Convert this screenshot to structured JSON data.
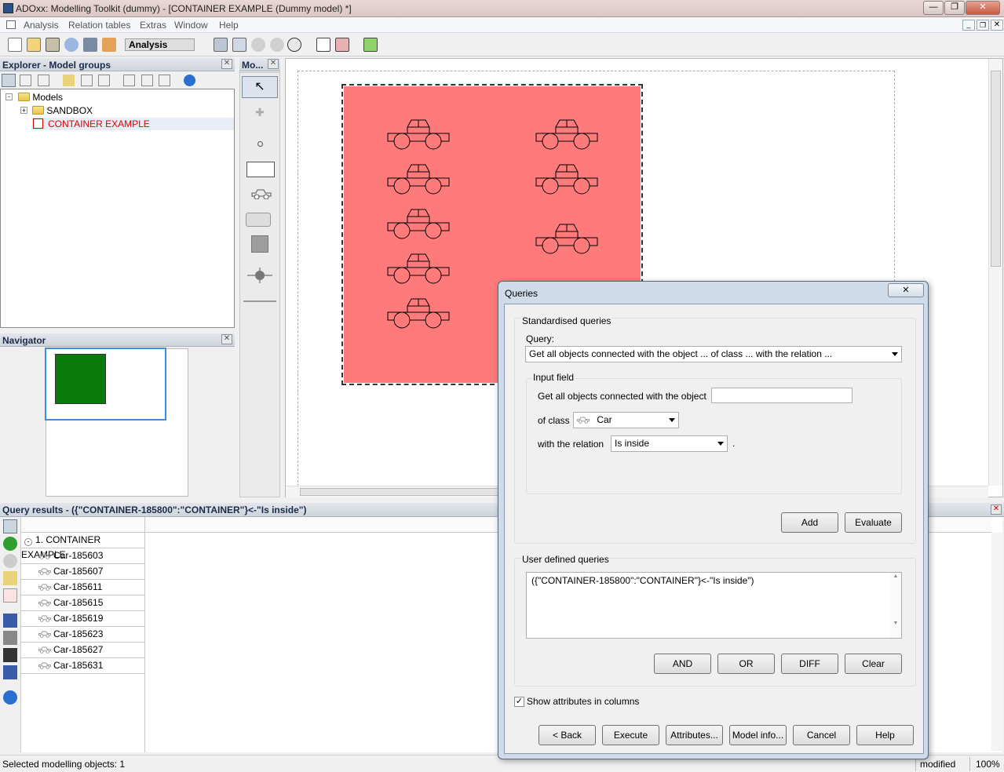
{
  "window": {
    "title": "ADOxx: Modelling Toolkit (dummy) - [CONTAINER EXAMPLE (Dummy model) *]"
  },
  "menu": [
    "Analysis",
    "Relation tables",
    "Extras",
    "Window",
    "Help"
  ],
  "toolbar": {
    "mode_value": "Analysis"
  },
  "explorer": {
    "title": "Explorer - Model groups",
    "root": "Models",
    "items": [
      "SANDBOX",
      "CONTAINER EXAMPLE"
    ]
  },
  "modelling_bar": {
    "title": "Mo..."
  },
  "navigator": {
    "title": "Navigator"
  },
  "query_results": {
    "title": "Query results - ({\"CONTAINER-185800\":\"CONTAINER\"}<-\"Is inside\")",
    "group": "1. CONTAINER EXAMPLE",
    "rows": [
      "Car-185603",
      "Car-185607",
      "Car-185611",
      "Car-185615",
      "Car-185619",
      "Car-185623",
      "Car-185627",
      "Car-185631"
    ]
  },
  "dialog": {
    "title": "Queries",
    "standardised_label": "Standardised queries",
    "query_label": "Query:",
    "query_value": "Get all objects connected with the object ... of class ... with the relation ...",
    "input_field_label": "Input field",
    "object_label": "Get all objects connected with the object",
    "object_value": "",
    "class_label": "of class",
    "class_value": "Car",
    "relation_label": "with the relation",
    "relation_value": "Is inside",
    "relation_suffix": ".",
    "add_label": "Add",
    "evaluate_label": "Evaluate",
    "user_defined_label": "User defined queries",
    "user_query": "({\"CONTAINER-185800\":\"CONTAINER\"}<-\"Is inside\")",
    "and_label": "AND",
    "or_label": "OR",
    "diff_label": "DIFF",
    "clear_label": "Clear",
    "show_attributes_label": "Show attributes in columns",
    "show_attributes_checked": true,
    "back_label": "< Back",
    "execute_label": "Execute",
    "attributes_label": "Attributes...",
    "model_info_label": "Model info...",
    "cancel_label": "Cancel",
    "help_label": "Help"
  },
  "status": {
    "left": "Selected modelling objects: 1",
    "state": "modified",
    "zoom": "100%"
  },
  "colors": {
    "container": "#ff7b7b",
    "navigator_preview": "#0a7a0a",
    "selection": "#3a8ee6"
  }
}
